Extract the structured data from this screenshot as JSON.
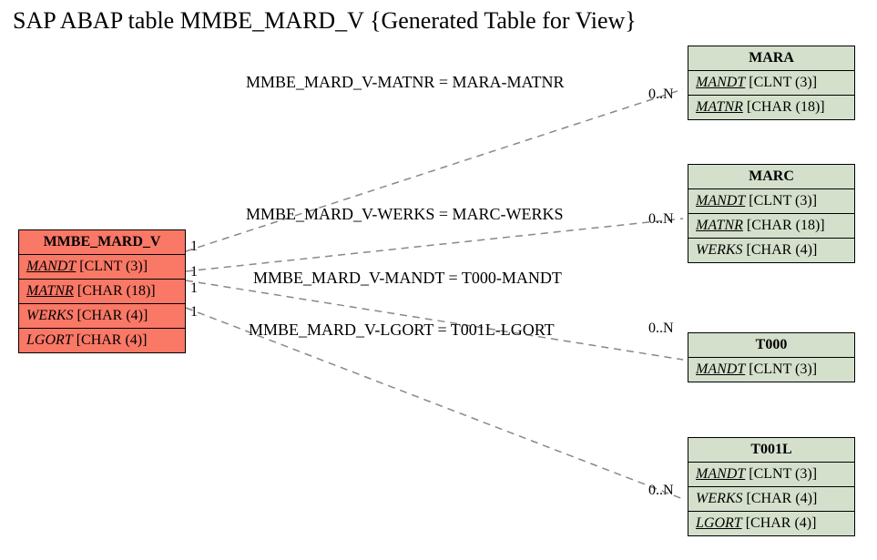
{
  "title": "SAP ABAP table MMBE_MARD_V {Generated Table for View}",
  "main": {
    "name": "MMBE_MARD_V",
    "fields": {
      "f0": {
        "label": "MANDT",
        "type": "[CLNT (3)]"
      },
      "f1": {
        "label": "MATNR",
        "type": "[CHAR (18)]"
      },
      "f2": {
        "label": "WERKS",
        "type": "[CHAR (4)]"
      },
      "f3": {
        "label": "LGORT",
        "type": "[CHAR (4)]"
      }
    }
  },
  "refs": {
    "mara": {
      "name": "MARA",
      "fields": {
        "f0": {
          "label": "MANDT",
          "type": "[CLNT (3)]"
        },
        "f1": {
          "label": "MATNR",
          "type": "[CHAR (18)]"
        }
      }
    },
    "marc": {
      "name": "MARC",
      "fields": {
        "f0": {
          "label": "MANDT",
          "type": "[CLNT (3)]"
        },
        "f1": {
          "label": "MATNR",
          "type": "[CHAR (18)]"
        },
        "f2": {
          "label": "WERKS",
          "type": "[CHAR (4)]"
        }
      }
    },
    "t000": {
      "name": "T000",
      "fields": {
        "f0": {
          "label": "MANDT",
          "type": "[CLNT (3)]"
        }
      }
    },
    "t001l": {
      "name": "T001L",
      "fields": {
        "f0": {
          "label": "MANDT",
          "type": "[CLNT (3)]"
        },
        "f1": {
          "label": "WERKS",
          "type": "[CHAR (4)]"
        },
        "f2": {
          "label": "LGORT",
          "type": "[CHAR (4)]"
        }
      }
    }
  },
  "rels": {
    "r0": {
      "text": "MMBE_MARD_V-MATNR = MARA-MATNR",
      "left": "1",
      "right": "0..N"
    },
    "r1": {
      "text": "MMBE_MARD_V-WERKS = MARC-WERKS",
      "left": "1",
      "right": "0..N"
    },
    "r2": {
      "text": "MMBE_MARD_V-MANDT = T000-MANDT",
      "left": "1",
      "right": ""
    },
    "r3": {
      "text": "MMBE_MARD_V-LGORT = T001L-LGORT",
      "left": "1",
      "right": "0..N"
    }
  },
  "extraCard": "0..N"
}
